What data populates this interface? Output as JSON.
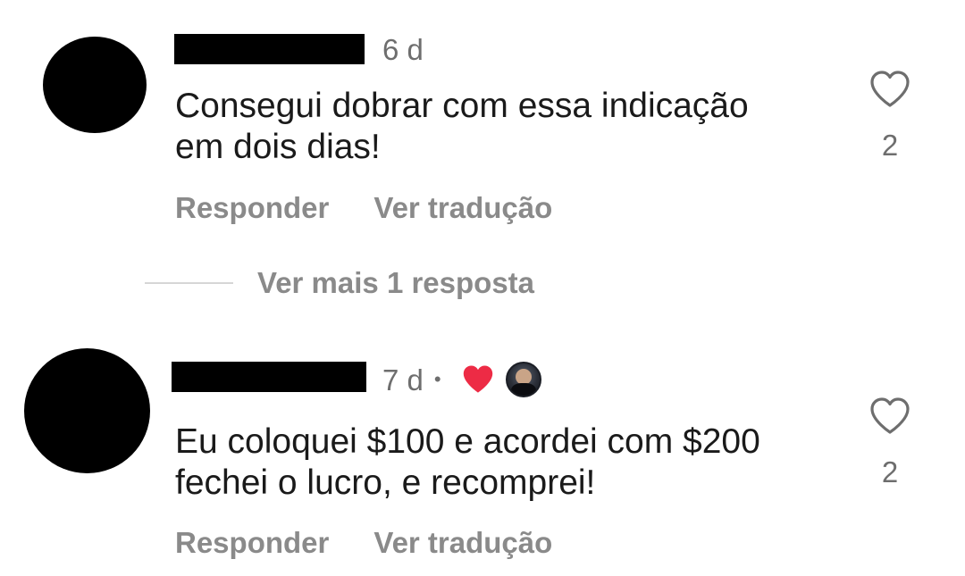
{
  "comments": [
    {
      "time": "6 d",
      "text": "Consegui dobrar com essa indicação em dois dias!",
      "like_count": "2",
      "reply_label": "Responder",
      "translate_label": "Ver tradução",
      "liked_by_creator": false
    },
    {
      "time": "7 d",
      "separator": "•",
      "text": "Eu coloquei $100 e acordei com $200 fechei o lucro, e recomprei!",
      "like_count": "2",
      "reply_label": "Responder",
      "translate_label": "Ver tradução",
      "liked_by_creator": true
    }
  ],
  "view_more_replies": "Ver mais 1 resposta",
  "colors": {
    "heart_liked": "#ed2b45",
    "secondary_text": "#8a8a8a"
  },
  "icons": {
    "like": "heart-outline-icon",
    "creator_like": "heart-filled-icon"
  }
}
